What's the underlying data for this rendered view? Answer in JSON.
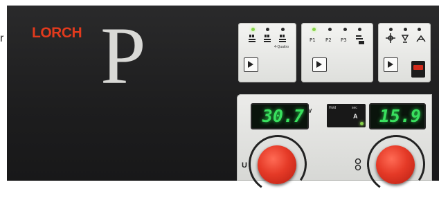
{
  "edge_text": "r",
  "brand": "LORCH",
  "model": "P",
  "modes": {
    "operating_label": "4-Quattro"
  },
  "programs": {
    "p1": "P1",
    "p2": "P2",
    "p3": "P3"
  },
  "display": {
    "voltage_value": "30.7",
    "voltage_unit": "V",
    "hold_label": "Hold",
    "sec_label": "sec",
    "mid_unit": "A",
    "current_value": "15.9"
  },
  "knobs": {
    "left_label": "U"
  },
  "colors": {
    "brand_red": "#e23a1d",
    "lcd_green": "#39e05e",
    "knob_red": "#e53a27",
    "led_green": "#88d24a"
  }
}
